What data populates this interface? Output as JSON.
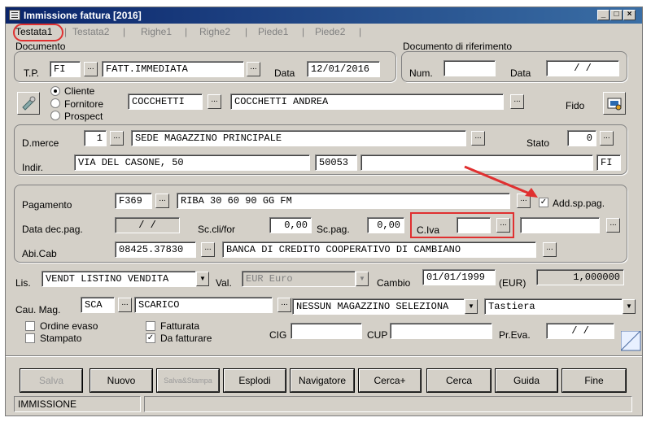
{
  "window": {
    "title": "Immissione fattura [2016]"
  },
  "tabs": [
    "Testata1",
    "Testata2",
    "Righe1",
    "Righe2",
    "Piede1",
    "Piede2"
  ],
  "documento": {
    "group_label": "Documento",
    "tp_label": "T.P.",
    "tp_value": "FI",
    "tp_desc": "FATT.IMMEDIATA",
    "data_label": "Data",
    "data_value": "12/01/2016"
  },
  "riferimento": {
    "group_label": "Documento di riferimento",
    "num_label": "Num.",
    "num_value": "",
    "data_label": "Data",
    "data_value": "/  /"
  },
  "anagrafica": {
    "options": [
      "Cliente",
      "Fornitore",
      "Prospect"
    ],
    "selected": "Cliente",
    "code": "COCCHETTI",
    "name": "COCCHETTI                    ANDREA",
    "fido_label": "Fido"
  },
  "destinazione": {
    "dmerce_label": "D.merce",
    "dmerce_code": "1",
    "dmerce_desc": "SEDE MAGAZZINO PRINCIPALE",
    "stato_label": "Stato",
    "stato_value": "0",
    "indir_label": "Indir.",
    "indir_value": "VIA DEL CASONE, 50",
    "cap": "50053",
    "citta": "",
    "prov": "FI"
  },
  "pagamento": {
    "label": "Pagamento",
    "code": "F369",
    "desc": "RIBA 30 60 90 GG FM",
    "add_label": "Add.sp.pag.",
    "add_checked": true,
    "data_dec_label": "Data dec.pag.",
    "data_dec_value": "/  /",
    "sc_clifor_label": "Sc.cli/for",
    "sc_clifor_value": "0,00",
    "sc_pag_label": "Sc.pag.",
    "sc_pag_value": "0,00",
    "civa_label": "C.Iva",
    "civa_value": "",
    "civa_desc": "",
    "abicab_label": "Abi.Cab",
    "abicab_value": "08425.37830",
    "banca": "BANCA DI CREDITO COOPERATIVO DI CAMBIANO"
  },
  "listino": {
    "lis_label": "Lis.",
    "lis_value": "VENDT  LISTINO VENDITA",
    "val_label": "Val.",
    "val_value": "EUR  Euro",
    "cambio_label": "Cambio",
    "cambio_date": "01/01/1999",
    "cambio_cur": "(EUR)",
    "cambio_value": "1,000000"
  },
  "magazzino": {
    "cau_label": "Cau. Mag.",
    "cau_code": "SCA",
    "cau_desc": "SCARICO",
    "mag_select": "NESSUN MAGAZZINO SELEZIONA",
    "input_select": "Tastiera"
  },
  "flags": {
    "ordine_evaso": "Ordine evaso",
    "stampato": "Stampato",
    "fatturata": "Fatturata",
    "da_fatturare": "Da fatturare",
    "cig_label": "CIG",
    "cup_label": "CUP",
    "preva_label": "Pr.Eva.",
    "preva_value": "/  /"
  },
  "buttons": [
    "Salva",
    "Nuovo",
    "Salva&Stampa",
    "Esplodi",
    "Navigatore",
    "Cerca+",
    "Cerca",
    "Guida",
    "Fine"
  ],
  "status": {
    "mode": "IMMISSIONE",
    "message": ""
  },
  "colors": {
    "annotation_red": "#e03030",
    "title_bar": "#0a246a"
  }
}
